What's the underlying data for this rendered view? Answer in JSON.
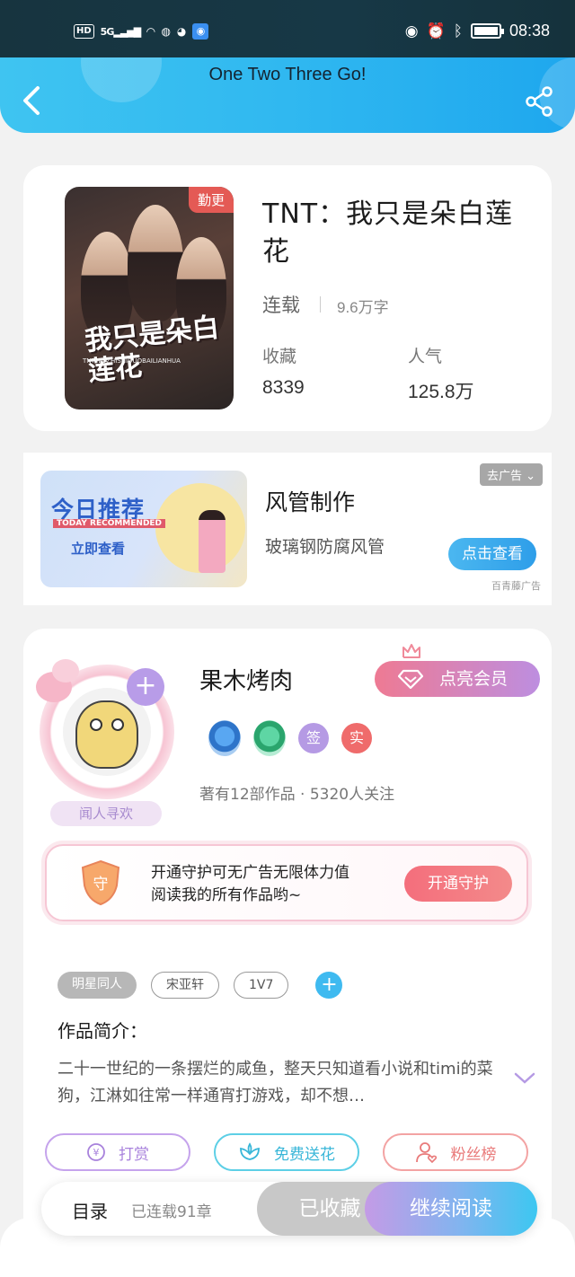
{
  "status_bar": {
    "network_badge": "HD",
    "network": "5G",
    "time": "08:38"
  },
  "header": {
    "title": "One Two Three Go!"
  },
  "book": {
    "cover_title": "我只是朵白莲花",
    "cover_subtitle": "TNTWOZHISHIDUOBAILIANHUA",
    "badge": "勤更",
    "title": "TNT：我只是朵白莲花",
    "status": "连载",
    "words": "9.6万字",
    "collect_label": "收藏",
    "collect_value": "8339",
    "popularity_label": "人气",
    "popularity_value": "125.8万"
  },
  "ad": {
    "image_title": "今日推荐",
    "image_en": "TODAY RECOMMENDED",
    "image_cta": "立即查看",
    "title": "风管制作",
    "subtitle": "玻璃钢防腐风管",
    "close_label": "去广告",
    "cta": "点击查看",
    "source": "百青藤广告"
  },
  "author": {
    "name": "果木烤肉",
    "tagline": "闻人寻欢",
    "vip_label": "点亮会员",
    "badge_sign": "签",
    "badge_real": "实",
    "stats": "著有12部作品 · 5320人关注",
    "guard_line1": "开通守护可无广告无限体力值",
    "guard_line2": "阅读我的所有作品哟~",
    "guard_shield": "守",
    "guard_button": "开通守护"
  },
  "tags": [
    "明星同人",
    "宋亚轩",
    "1V7"
  ],
  "intro": {
    "title": "作品简介：",
    "text": "二十一世纪的一条摆烂的咸鱼，整天只知道看小说和timi的菜狗，江淋如往常一样通宵打游戏，却不想…"
  },
  "actions": {
    "reward": "打赏",
    "flower": "免费送花",
    "fans": "粉丝榜"
  },
  "bottom": {
    "toc": "目录",
    "chapters": "已连载91章",
    "collected": "已收藏",
    "continue": "继续阅读"
  },
  "colors": {
    "header_blue": "#30b8f0",
    "accent_purple": "#b59ae4",
    "accent_red": "#ef6b6b",
    "cta_blue": "#2e9ee9"
  }
}
